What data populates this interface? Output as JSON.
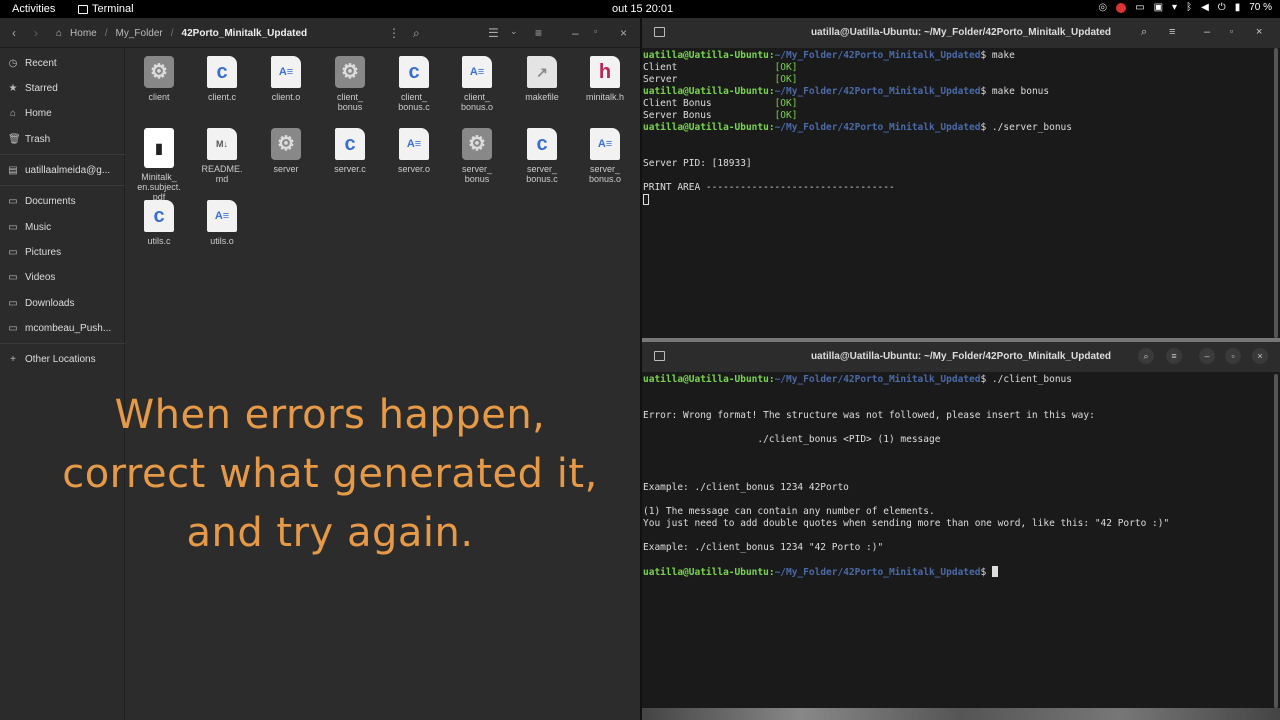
{
  "topbar": {
    "activities": "Activities",
    "app_name": "Terminal",
    "clock": "out 15  20:01",
    "battery": "70 %"
  },
  "files": {
    "breadcrumbs": [
      "Home",
      "My_Folder",
      "42Porto_Minitalk_Updated"
    ],
    "sidebar": [
      {
        "label": "Recent",
        "icon": "clock-icon"
      },
      {
        "label": "Starred",
        "icon": "star-icon"
      },
      {
        "label": "Home",
        "icon": "home-icon"
      },
      {
        "label": "Trash",
        "icon": "trash-icon"
      },
      {
        "label": "uatillaalmeida@g...",
        "icon": "account-icon"
      },
      {
        "label": "Documents",
        "icon": "folder-icon"
      },
      {
        "label": "Music",
        "icon": "folder-icon"
      },
      {
        "label": "Pictures",
        "icon": "folder-icon"
      },
      {
        "label": "Videos",
        "icon": "folder-icon"
      },
      {
        "label": "Downloads",
        "icon": "folder-icon"
      },
      {
        "label": "mcombeau_Push...",
        "icon": "folder-icon"
      },
      {
        "label": "Other Locations",
        "icon": "plus-icon"
      }
    ],
    "items": [
      {
        "name": "client",
        "type": "exec",
        "glyph": "⚙"
      },
      {
        "name": "client.c",
        "type": "csrc",
        "glyph": "c"
      },
      {
        "name": "client.o",
        "type": "obj",
        "glyph": "A≡"
      },
      {
        "name": "client_\nbonus",
        "type": "exec",
        "glyph": "⚙"
      },
      {
        "name": "client_\nbonus.c",
        "type": "csrc",
        "glyph": "c"
      },
      {
        "name": "client_\nbonus.o",
        "type": "obj",
        "glyph": "A≡"
      },
      {
        "name": "makefile",
        "type": "mk",
        "glyph": "↗"
      },
      {
        "name": "minitalk.h",
        "type": "hdr",
        "glyph": "h"
      },
      {
        "name": "Minitalk_\nen.subject.\npdf",
        "type": "pdf",
        "glyph": "▮"
      },
      {
        "name": "README.\nmd",
        "type": "md",
        "glyph": "M↓"
      },
      {
        "name": "server",
        "type": "exec",
        "glyph": "⚙"
      },
      {
        "name": "server.c",
        "type": "csrc",
        "glyph": "c"
      },
      {
        "name": "server.o",
        "type": "obj",
        "glyph": "A≡"
      },
      {
        "name": "server_\nbonus",
        "type": "exec",
        "glyph": "⚙"
      },
      {
        "name": "server_\nbonus.c",
        "type": "csrc",
        "glyph": "c"
      },
      {
        "name": "server_\nbonus.o",
        "type": "obj",
        "glyph": "A≡"
      },
      {
        "name": "utils.c",
        "type": "csrc",
        "glyph": "c"
      },
      {
        "name": "utils.o",
        "type": "obj",
        "glyph": "A≡"
      }
    ]
  },
  "caption": {
    "line1": "When errors happen,",
    "line2": "correct what generated it,",
    "line3": "and try again."
  },
  "terminal_top": {
    "title": "uatilla@Uatilla-Ubuntu: ~/My_Folder/42Porto_Minitalk_Updated",
    "prompt_user": "uatilla@Uatilla-Ubuntu:",
    "prompt_path": "~/My_Folder/42Porto_Minitalk_Updated",
    "cmd1": "$ make",
    "out1": "Client                 ",
    "out2": "Server                 ",
    "ok": "[OK]",
    "cmd2": "$ make bonus",
    "out3": "Client Bonus           ",
    "out4": "Server Bonus           ",
    "cmd3": "$ ./server_bonus",
    "pid": "Server PID: [18933]",
    "print_area": "PRINT AREA ---------------------------------"
  },
  "terminal_bottom": {
    "title": "uatilla@Uatilla-Ubuntu: ~/My_Folder/42Porto_Minitalk_Updated",
    "prompt_user": "uatilla@Uatilla-Ubuntu:",
    "prompt_path": "~/My_Folder/42Porto_Minitalk_Updated",
    "cmd1": "$ ./client_bonus",
    "err": "Error: Wrong format! The structure was not followed, please insert in this way:",
    "usage": "                    ./client_bonus <PID> (1) message",
    "ex1": "Example: ./client_bonus 1234 42Porto",
    "note1": "(1) The message can contain any number of elements.",
    "note2": "You just need to add double quotes when sending more than one word, like this: \"42 Porto :)\"",
    "ex2": "Example: ./client_bonus 1234 \"42 Porto :)\"",
    "cmd_end": "$ "
  }
}
